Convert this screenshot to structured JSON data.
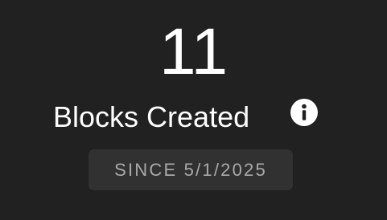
{
  "stat": {
    "value": "11",
    "label": "Blocks Created",
    "info_icon": "info-icon",
    "since": "SINCE 5/1/2025"
  },
  "colors": {
    "background": "#212121",
    "text_primary": "#ffffff",
    "badge_background": "#313131",
    "badge_text": "#a9a9a9"
  }
}
